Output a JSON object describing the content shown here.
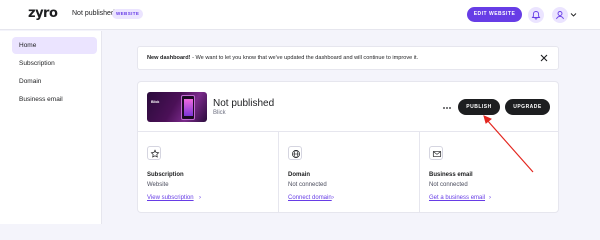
{
  "header": {
    "logo": "zyro",
    "site_status": "Not published",
    "site_badge": "WEBSITE",
    "edit_button": "EDIT WEBSITE",
    "icons": [
      "bell-icon",
      "user-icon",
      "chevron-down-icon"
    ]
  },
  "sidebar": {
    "items": [
      {
        "label": "Home",
        "active": true
      },
      {
        "label": "Subscription",
        "active": false
      },
      {
        "label": "Domain",
        "active": false
      },
      {
        "label": "Business email",
        "active": false
      }
    ]
  },
  "notice": {
    "bold": "New dashboard!",
    "text": " - We want to let you know that we've updated the dashboard and will continue to improve it."
  },
  "site_card": {
    "title": "Not published",
    "template": "Blick",
    "thumb_text": "Blick",
    "publish_button": "PUBLISH",
    "upgrade_button": "UPGRADE",
    "columns": [
      {
        "icon": "star-icon",
        "title": "Subscription",
        "value": "Website",
        "link": "View subscription"
      },
      {
        "icon": "globe-icon",
        "title": "Domain",
        "value": "Not connected",
        "link": "Connect domain"
      },
      {
        "icon": "mail-icon",
        "title": "Business email",
        "value": "Not connected",
        "link": "Get a business email"
      }
    ]
  },
  "colors": {
    "accent": "#673de6",
    "accent_light": "#ebe4ff",
    "dark_button": "#1d1e20",
    "annotation_arrow": "#e3261f"
  }
}
